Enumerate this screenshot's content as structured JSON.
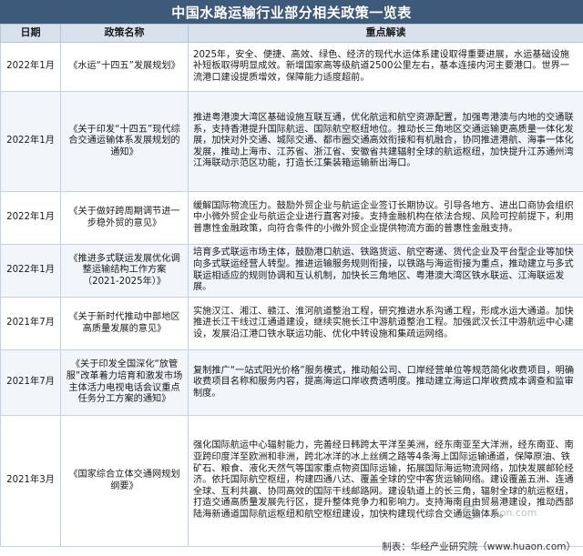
{
  "title": "中国水路运输行业部分相关政策一览表",
  "columns": {
    "date": "日期",
    "name": "政策名称",
    "points": "重点解读"
  },
  "rows": [
    {
      "date": "2022年1月",
      "name": "《水运“十四五”发展规划》",
      "points": "2025年，安全、便捷、高效、绿色、经济的现代水运体系建设取得重要进展，水运基础设施补短板取得明显成效。新增国家高等级航道2500公里左右，基本连接内河主要港口。世界一流港口建设提质增效，保障能力适度超前。"
    },
    {
      "date": "2022年1月",
      "name": "《关于印发“十四五”现代综合交通运输体系发展规划的通知》",
      "points": "推进粤港澳大湾区基础设施互联互通，优化航运和航空资源配置，加强粤港澳与内地的交通联系，支持香港提升国际航运、国际航空枢纽地位。推动长三角地区交通运输更高质量一体化发展，加快对外交通、城际交通、都市圈交通高效衔接和有机融合，协同推进港航、海事一体化发展，推动上海市、江苏省、浙江省、安徽省共建辐射全球的航运枢纽，加快提升江苏通州湾江海联动示范区功能，打造长江集装箱运输新出海口。"
    },
    {
      "date": "2022年1月",
      "name": "《关于做好跨周期调节进一步稳外贸的意见》",
      "points": "缓解国际物流压力。鼓励外贸企业与航运企业签订长期协议。引导各地方、进出口商协会组织中小微外贸企业与航运企业进行直客对接。支持金融机构在依法合规、风险可控前提下，利用普惠性金融政策，向符合条件的小微外贸企业提供物流方面的普惠性金融支持。"
    },
    {
      "date": "2022年1月",
      "name": "《推进多式联运发展优化调整运输结构工作方案（2021-2025年）》",
      "points": "培育多式联运市场主体，鼓励港口航运、铁路货运、航空寄递、货代企业及平台型企业等加快向多式联运经营人转型。推进运输服务规则衔接，以铁路与海运衔接为重点，推动建立与多式联运相适应的规则协调和互认机制，加快长三角地区、粤港澳大湾区铁水联运、江海联运发展。"
    },
    {
      "date": "2021年7月",
      "name": "《关于新时代推动中部地区高质量发展的意见》",
      "points": "实施汉江、湘江、赣江、淮河航道整治工程，研究推进水系沟通工程，形成水运大通道。加快推进长江干线过江通道建设，继续实施长江中游航道整治工程。加强武汉长江中游航运中心建设，发展沿江港口铁水联运功能、优化中转设施和集疏运网络。"
    },
    {
      "date": "2021年7月",
      "name": "《关于印发全国深化“放管服”改革着力培育和激发市场主体活力电视电话会议重点任务分工方案的通知》",
      "points": "复制推广“一站式阳光价格”服务模式，推动船公司、口岸经营单位等规范简化收费项目，明确收费项目名称和服务内容，提高海运口岸收费透明度。推动建立海运口岸收费成本调查和监审制度。"
    },
    {
      "date": "2021年3月",
      "name": "《国家综合立体交通网规划纲要》",
      "points": "强化国际航运中心辐射能力，完善经日韩跨太平洋至美洲，经东南亚至大洋洲，经东南亚、南亚跨印度洋至欧洲和非洲，跨北冰洋的冰上丝绸之路等4条海上国际运输通道，保障原油、铁矿石、粮食、液化天然气等国家重点物资国际运输，拓展国际海运物流网络，加快发展邮轮经济。依托国际航空枢纽，构建四通八达、覆盖全球的空中客货运输网络。建设覆盖五洲、连通全球、互利共赢、协同高效的国际干线邮路网。建设轨道上的长三角，辐射全球的航运枢纽，打造交通高质量发展先行区，提升整体竞争力和影响力。支持海南自由贸易港建设，推动西部陆海新通道国际航运枢纽和航空枢纽建设，加快构建现代综合交通运输体系。"
    }
  ],
  "footer": "制表：华经产业研究院（www.huaon.com）",
  "watermark": "huaon.com"
}
